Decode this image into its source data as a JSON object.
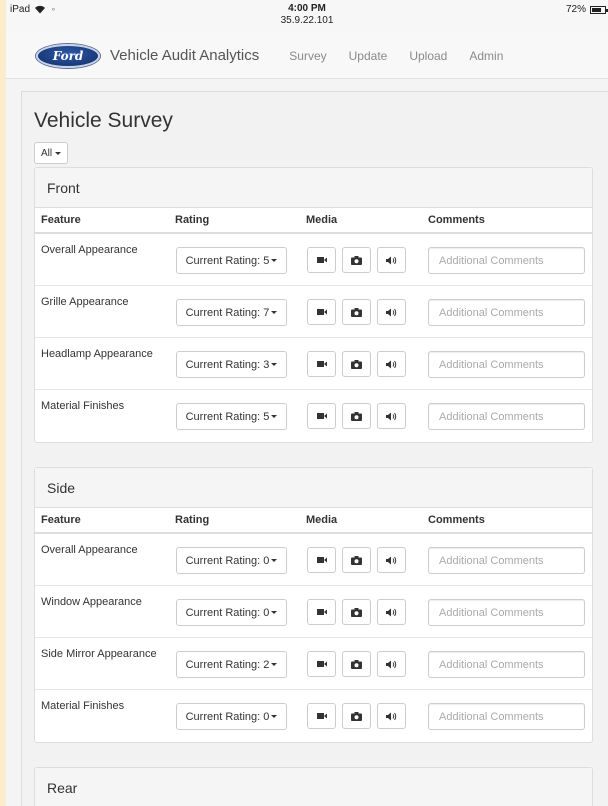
{
  "statusbar": {
    "device": "iPad",
    "time": "4:00 PM",
    "ip": "35.9.22.101",
    "battery": "72%"
  },
  "navbar": {
    "logo_text": "Ford",
    "brand": "Vehicle Audit Analytics",
    "links": [
      "Survey",
      "Update",
      "Upload",
      "Admin"
    ]
  },
  "page": {
    "title": "Vehicle Survey",
    "filter_label": "All"
  },
  "columns": {
    "feature": "Feature",
    "rating": "Rating",
    "media": "Media",
    "comments": "Comments"
  },
  "comment_placeholder": "Additional Comments",
  "icons": {
    "video": "video-camera-icon",
    "photo": "camera-icon",
    "audio": "speaker-icon"
  },
  "sections": [
    {
      "title": "Front",
      "rows": [
        {
          "feature": "Overall Appearance",
          "rating": "Current Rating: 5"
        },
        {
          "feature": "Grille Appearance",
          "rating": "Current Rating: 7"
        },
        {
          "feature": "Headlamp Appearance",
          "rating": "Current Rating: 3"
        },
        {
          "feature": "Material Finishes",
          "rating": "Current Rating: 5"
        }
      ]
    },
    {
      "title": "Side",
      "rows": [
        {
          "feature": "Overall Appearance",
          "rating": "Current Rating: 0"
        },
        {
          "feature": "Window Appearance",
          "rating": "Current Rating: 0"
        },
        {
          "feature": "Side Mirror Appearance",
          "rating": "Current Rating: 2"
        },
        {
          "feature": "Material Finishes",
          "rating": "Current Rating: 0"
        }
      ]
    },
    {
      "title": "Rear",
      "rows": []
    }
  ]
}
